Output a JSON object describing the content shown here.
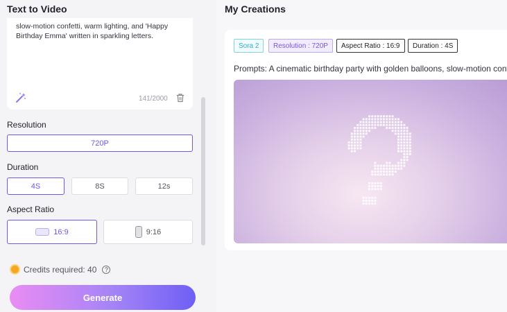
{
  "left_panel": {
    "title": "Text to Video",
    "prompt_text": "slow-motion confetti, warm lighting, and 'Happy Birthday Emma' written in sparkling letters.",
    "char_counter": "141/2000",
    "resolution": {
      "label": "Resolution",
      "options": [
        "720P"
      ],
      "selected": "720P"
    },
    "duration": {
      "label": "Duration",
      "options": [
        "4S",
        "8S",
        "12s"
      ],
      "selected": "4S"
    },
    "aspect_ratio": {
      "label": "Aspect Ratio",
      "options": [
        "16:9",
        "9:16"
      ],
      "selected": "16:9"
    },
    "credits_text": "Credits required: 40",
    "help_glyph": "?",
    "generate_label": "Generate"
  },
  "right_panel": {
    "title": "My Creations",
    "tags": {
      "model": "Sora 2",
      "resolution": "Resolution : 720P",
      "aspect_ratio": "Aspect Ratio : 16:9",
      "duration": "Duration : 4S"
    },
    "prompt_line": "Prompts: A cinematic birthday party with golden balloons, slow-motion confetti, warm lighting, and 'Happy Birthday Emma' written in sparkling letters."
  },
  "icons": [
    "magic-wand-icon",
    "trash-icon",
    "coin-icon",
    "help-icon",
    "loading-dots-icon"
  ],
  "colors": {
    "accent": "#6e57e8",
    "generate_start": "#ea8cf4",
    "generate_end": "#6e5ff5",
    "sora_tag": "#27b3cf"
  }
}
